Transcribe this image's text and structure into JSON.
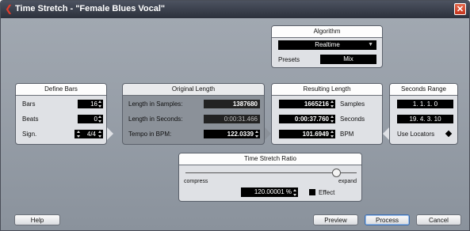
{
  "window": {
    "title": "Time Stretch - \"Female Blues Vocal\""
  },
  "algorithm": {
    "title": "Algorithm",
    "value": "Realtime",
    "presets_label": "Presets",
    "presets_value": "Mix"
  },
  "define_bars": {
    "title": "Define Bars",
    "bars_label": "Bars",
    "bars_value": "16",
    "beats_label": "Beats",
    "beats_value": "0",
    "sign_label": "Sign.",
    "sign_value": "4/4"
  },
  "original_length": {
    "title": "Original Length",
    "samples_label": "Length in Samples:",
    "samples_value": "1387680",
    "seconds_label": "Length in Seconds:",
    "seconds_value": "0:00:31.466",
    "bpm_label": "Tempo in BPM:",
    "bpm_value": "122.0339"
  },
  "resulting_length": {
    "title": "Resulting Length",
    "samples_value": "1665216",
    "samples_label": "Samples",
    "seconds_value": "0:00:37.760",
    "seconds_label": "Seconds",
    "bpm_value": "101.6949",
    "bpm_label": "BPM"
  },
  "seconds_range": {
    "title": "Seconds Range",
    "start": "1. 1. 1.   0",
    "end": "19. 4. 3. 10",
    "use_locators_label": "Use Locators"
  },
  "ratio": {
    "title": "Time Stretch Ratio",
    "compress_label": "compress",
    "expand_label": "expand",
    "value": "120.00001 %",
    "effect_label": "Effect",
    "slider_fraction": 0.88
  },
  "buttons": {
    "help": "Help",
    "preview": "Preview",
    "process": "Process",
    "cancel": "Cancel"
  },
  "colors": {
    "accent_red": "#e23b2a",
    "titlebar": "#2c313c",
    "value_bg": "#000000"
  }
}
